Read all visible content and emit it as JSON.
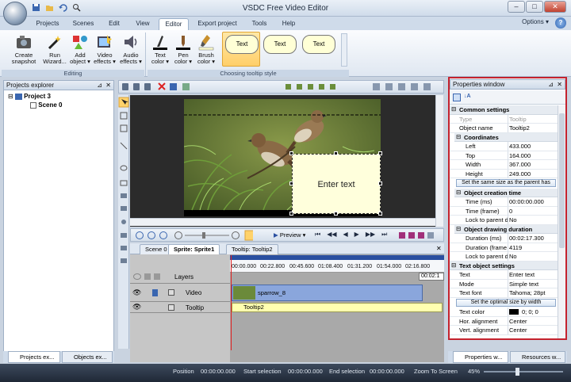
{
  "window": {
    "title": "VSDC Free Video Editor",
    "controls": [
      "–",
      "□",
      "✕"
    ]
  },
  "menu": {
    "tabs": [
      "Projects",
      "Scenes",
      "Edit",
      "View",
      "Editor",
      "Export project",
      "Tools",
      "Help"
    ],
    "active": "Editor",
    "options_label": "Options",
    "options_arrow": "▾",
    "help": "?"
  },
  "ribbon": {
    "editing": {
      "label": "Editing",
      "buttons": [
        {
          "l1": "Create",
          "l2": "snapshot"
        },
        {
          "l1": "Run",
          "l2": "Wizard..."
        },
        {
          "l1": "Add",
          "l2": "object ▾"
        },
        {
          "l1": "Video",
          "l2": "effects ▾"
        },
        {
          "l1": "Audio",
          "l2": "effects ▾"
        }
      ]
    },
    "style": {
      "label": "Choosing tooltip style",
      "buttons": [
        {
          "l1": "Text",
          "l2": "color ▾"
        },
        {
          "l1": "Pen",
          "l2": "color ▾"
        },
        {
          "l1": "Brush",
          "l2": "color ▾"
        }
      ],
      "bubbles": [
        "Text",
        "Text",
        "Text"
      ]
    }
  },
  "projects_explorer": {
    "title": "Projects explorer",
    "pin": "⊿",
    "close": "✕",
    "tree": [
      {
        "label": "Project 3",
        "toggle": "⊟"
      },
      {
        "label": "Scene 0"
      }
    ]
  },
  "left_bottom_tabs": [
    "Projects ex...",
    "Objects ex..."
  ],
  "canvas": {
    "tooltip_text": "Enter text"
  },
  "preview": {
    "label": "Preview",
    "label_arrow": "▾",
    "transport": [
      "⏮",
      "◀◀",
      "◀",
      "▶",
      "▶▶",
      "⏭"
    ]
  },
  "timeline": {
    "tabs": [
      "Scene 0",
      "Sprite: Sprite1",
      "Tooltip: Tooltip2"
    ],
    "tab_close": "✕",
    "ruler": [
      "00:00.000",
      "00:22.800",
      "00:45.600",
      "01:08.400",
      "01:31.200",
      "01:54.000",
      "02:16.800"
    ],
    "end_marker": "00:02:1",
    "layers_label": "Layers",
    "tracks": [
      {
        "name": "Video",
        "clip": "sparrow_8"
      },
      {
        "name": "Tooltip",
        "clip": "Tooltip2"
      }
    ]
  },
  "status": {
    "position_label": "Position",
    "position": "00:00:00.000",
    "start_label": "Start selection",
    "start": "00:00:00.000",
    "end_label": "End selection",
    "end": "00:00:00.000",
    "zoom_label": "Zoom To Screen",
    "zoom": "45%"
  },
  "properties": {
    "title": "Properties window",
    "pin": "⊿",
    "close": "✕",
    "sections": {
      "common": "Common settings",
      "coordinates": "Coordinates",
      "creation": "Object creation time",
      "duration": "Object drawing duration",
      "text": "Text object settings"
    },
    "type": {
      "k": "Type",
      "v": "Tooltip"
    },
    "object_name": {
      "k": "Object name",
      "v": "Tooltip2"
    },
    "left": {
      "k": "Left",
      "v": "433.000"
    },
    "top": {
      "k": "Top",
      "v": "164.000"
    },
    "width": {
      "k": "Width",
      "v": "367.000"
    },
    "height": {
      "k": "Height",
      "v": "249.000"
    },
    "same_size_btn": "Set the same size as the parent has",
    "time_ms": {
      "k": "Time (ms)",
      "v": "00:00:00.000"
    },
    "time_frame": {
      "k": "Time (frame)",
      "v": "0"
    },
    "lock1": {
      "k": "Lock to parent d",
      "v": "No"
    },
    "dur_ms": {
      "k": "Duration (ms)",
      "v": "00:02:17.300"
    },
    "dur_frame": {
      "k": "Duration (frame",
      "v": "4119"
    },
    "lock2": {
      "k": "Lock to parent d",
      "v": "No"
    },
    "text": {
      "k": "Text",
      "v": "Enter text"
    },
    "mode": {
      "k": "Mode",
      "v": "Simple text"
    },
    "font": {
      "k": "Text font",
      "v": "Tahoma; 28pt"
    },
    "optimal_btn": "Set the optimal size by width",
    "text_color": {
      "k": "Text color",
      "v": "0; 0; 0"
    },
    "hor": {
      "k": "Hor. alignment",
      "v": "Center"
    },
    "vert": {
      "k": "Vert. alignment",
      "v": "Center"
    }
  },
  "right_bottom_tabs": [
    "Properties w...",
    "Resources w..."
  ],
  "colors": {
    "accent_red": "#c4222e",
    "ribbon_active": "#ffcf6a",
    "clip_video": "#8aa6dc",
    "clip_tooltip": "#ffffb0"
  }
}
